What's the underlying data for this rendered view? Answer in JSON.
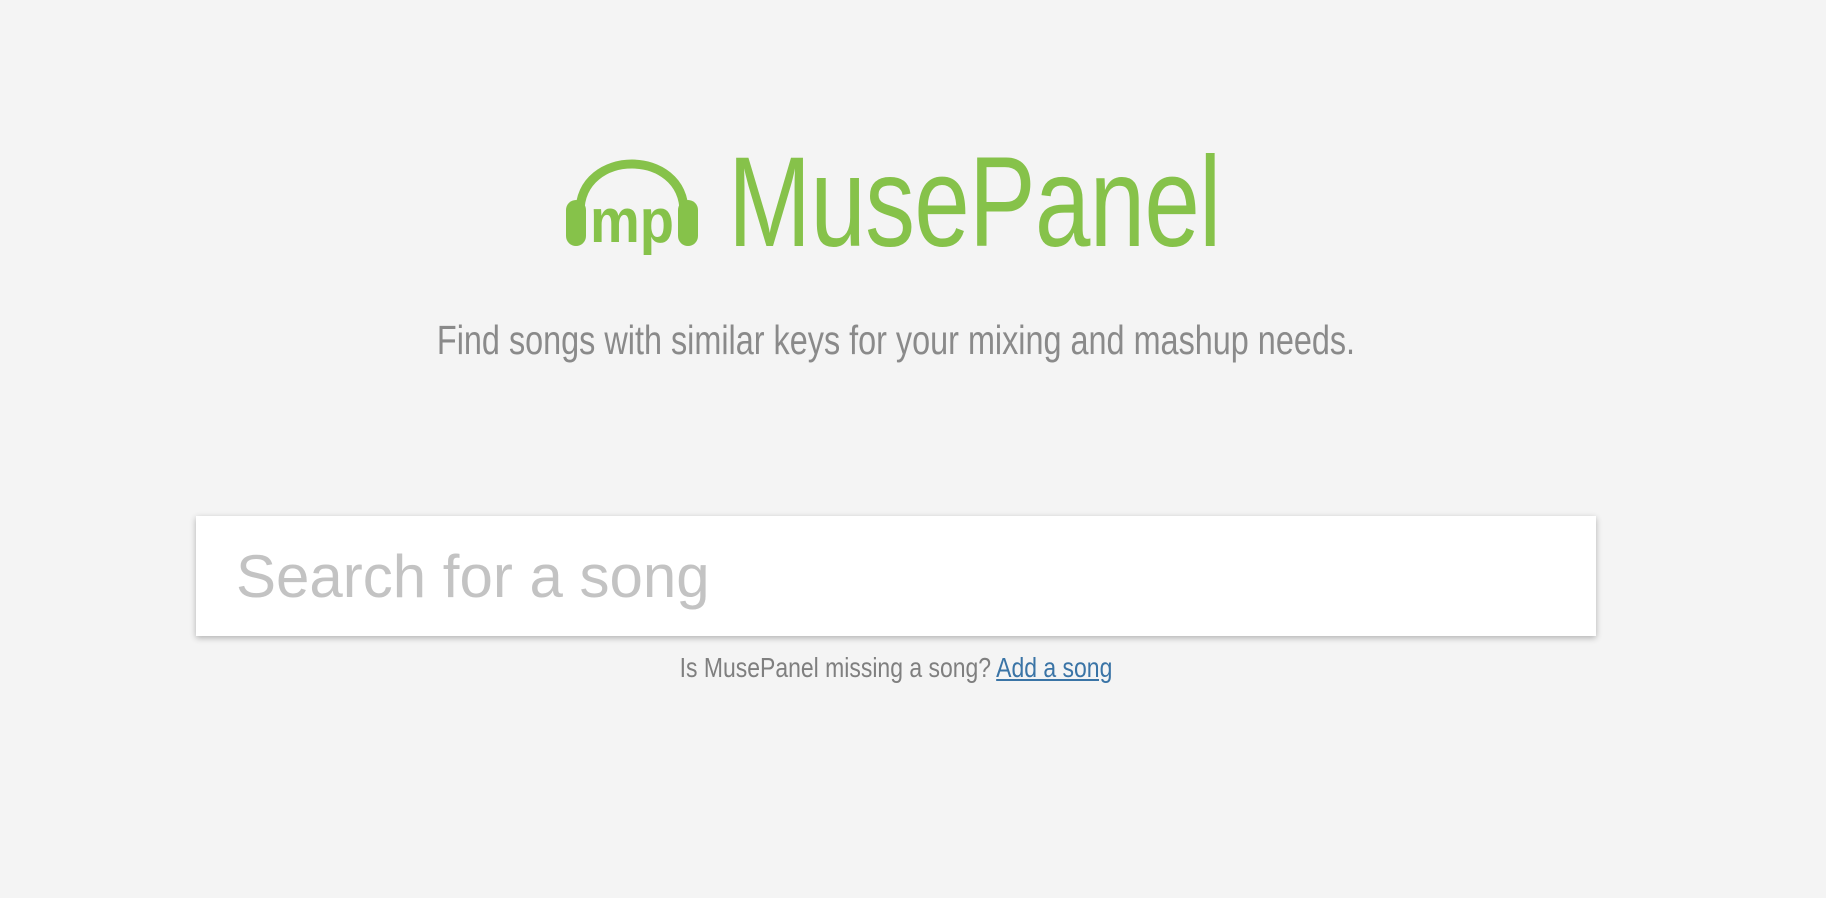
{
  "brand": {
    "logo_icon": "headphones-mp-logo-icon",
    "logo_text": "mp",
    "name": "MusePanel",
    "color": "#86c24a"
  },
  "tagline": "Find songs with similar keys for your mixing and mashup needs.",
  "search": {
    "placeholder": "Search for a song",
    "value": ""
  },
  "helper": {
    "text": "Is MusePanel missing a song?",
    "link_label": "Add a song",
    "link_color": "#3a74a6"
  },
  "colors": {
    "background": "#f4f4f4",
    "muted_text": "#8a8a8a"
  }
}
